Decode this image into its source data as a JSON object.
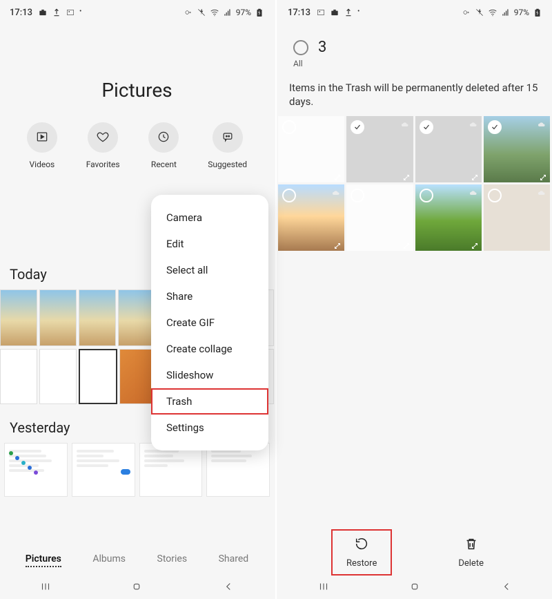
{
  "left": {
    "status": {
      "time": "17:13",
      "battery": "97%"
    },
    "title": "Pictures",
    "categories": [
      {
        "label": "Videos"
      },
      {
        "label": "Favorites"
      },
      {
        "label": "Recent"
      },
      {
        "label": "Suggested"
      }
    ],
    "sections": {
      "today": "Today",
      "yesterday": "Yesterday"
    },
    "menu": [
      "Camera",
      "Edit",
      "Select all",
      "Share",
      "Create GIF",
      "Create collage",
      "Slideshow",
      "Trash",
      "Settings"
    ],
    "tabs": [
      "Pictures",
      "Albums",
      "Stories",
      "Shared"
    ]
  },
  "right": {
    "status": {
      "time": "17:13",
      "battery": "97%"
    },
    "select": {
      "count": "3",
      "all_label": "All"
    },
    "trash_message": "Items in the Trash will be permanently deleted after 15 days.",
    "thumbs": [
      {
        "selected": false
      },
      {
        "selected": true
      },
      {
        "selected": true
      },
      {
        "selected": true
      },
      {
        "selected": false
      },
      {
        "selected": false
      },
      {
        "selected": false
      },
      {
        "selected": false
      }
    ],
    "actions": {
      "restore": "Restore",
      "delete": "Delete"
    }
  }
}
